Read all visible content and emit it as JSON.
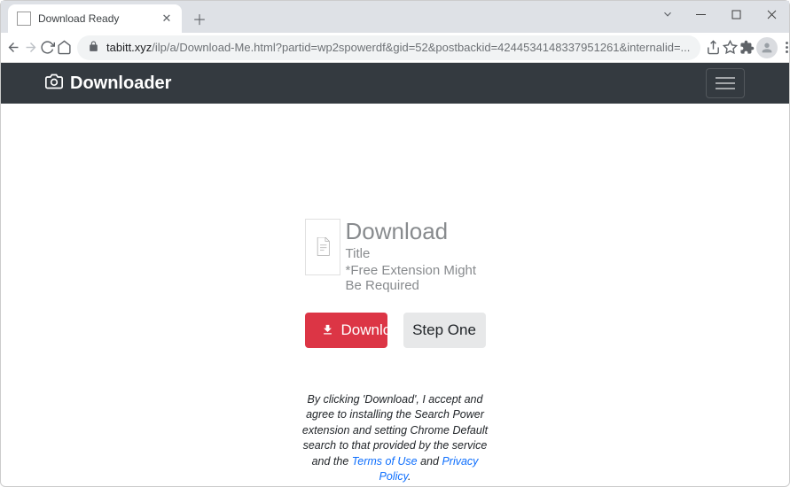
{
  "chrome": {
    "tab_title": "Download Ready",
    "url_host": "tabitt.xyz",
    "url_path": "/ilp/a/Download-Me.html?partid=wp2spowerdf&gid=52&postbackid=4244534148337951261&internalid=..."
  },
  "nav": {
    "brand": "Downloader"
  },
  "content": {
    "heading": "Download",
    "subtitle": "Title",
    "note": "*Free Extension Might Be Required",
    "download_btn": "Download",
    "step_btn": "Step One"
  },
  "disclaimer": {
    "text_1": "By clicking 'Download', I accept and agree to installing the Search Power extension and setting Chrome Default search to that provided by the service and the ",
    "terms": "Terms of Use",
    "text_2": " and ",
    "privacy": "Privacy Policy",
    "text_3": "."
  }
}
